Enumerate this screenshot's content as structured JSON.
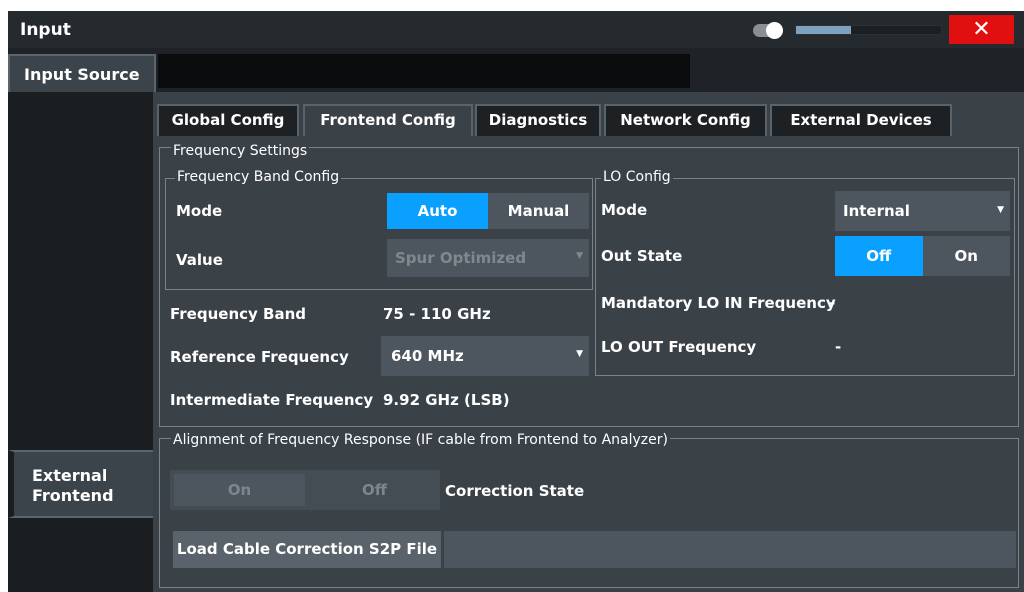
{
  "window": {
    "title": "Input",
    "close_label": "✕",
    "slider_fill_percent": 38
  },
  "top_tab": {
    "label": "Input Source"
  },
  "sidebar": {
    "items": [
      {
        "label": "External Frontend"
      }
    ]
  },
  "tabs": [
    {
      "label": "Global Config",
      "active": false
    },
    {
      "label": "Frontend Config",
      "active": true
    },
    {
      "label": "Diagnostics",
      "active": false
    },
    {
      "label": "Network Config",
      "active": false
    },
    {
      "label": "External Devices",
      "active": false
    }
  ],
  "frequency_settings": {
    "title": "Frequency Settings",
    "band_config": {
      "title": "Frequency Band Config",
      "mode_label": "Mode",
      "mode_options": [
        "Auto",
        "Manual"
      ],
      "mode_selected": "Auto",
      "value_label": "Value",
      "value_selected": "Spur Optimized"
    },
    "frequency_band_label": "Frequency Band",
    "frequency_band_value": "75 - 110 GHz",
    "reference_frequency_label": "Reference Frequency",
    "reference_frequency_value": "640 MHz",
    "intermediate_frequency_label": "Intermediate Frequency",
    "intermediate_frequency_value": "9.92 GHz (LSB)",
    "lo_config": {
      "title": "LO Config",
      "mode_label": "Mode",
      "mode_value": "Internal",
      "out_state_label": "Out State",
      "out_state_options": [
        "Off",
        "On"
      ],
      "out_state_selected": "Off",
      "mandatory_lo_in_label": "Mandatory LO IN Frequency",
      "mandatory_lo_in_value": "-",
      "lo_out_label": "LO OUT Frequency",
      "lo_out_value": "-"
    }
  },
  "alignment": {
    "title": "Alignment of Frequency Response (IF cable from Frontend to Analyzer)",
    "correction_options": [
      "On",
      "Off"
    ],
    "correction_label": "Correction State",
    "load_button_label": "Load Cable Correction S2P File",
    "file_path": ""
  },
  "colors": {
    "accent": "#0aa0ff",
    "close": "#e01010",
    "panel": "#3a4147",
    "control": "#4d565e"
  }
}
